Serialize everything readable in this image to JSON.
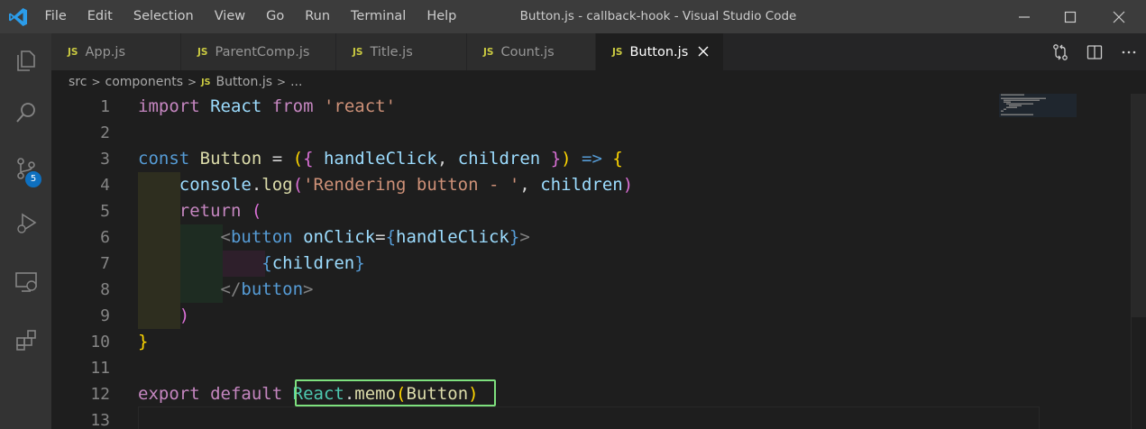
{
  "titlebar": {
    "menu": [
      "File",
      "Edit",
      "Selection",
      "View",
      "Go",
      "Run",
      "Terminal",
      "Help"
    ],
    "title": "Button.js - callback-hook - Visual Studio Code"
  },
  "activitybar": {
    "icons": [
      "explorer-icon",
      "search-icon",
      "source-control-icon",
      "run-debug-icon",
      "remote-explorer-icon",
      "extensions-icon"
    ],
    "source_control_badge": "5"
  },
  "tabs": [
    {
      "label": "App.js",
      "badge": "JS",
      "active": false
    },
    {
      "label": "ParentComp.js",
      "badge": "JS",
      "active": false
    },
    {
      "label": "Title.js",
      "badge": "JS",
      "active": false
    },
    {
      "label": "Count.js",
      "badge": "JS",
      "active": false
    },
    {
      "label": "Button.js",
      "badge": "JS",
      "active": true
    }
  ],
  "breadcrumb": {
    "parts": [
      "src",
      "components"
    ],
    "file_badge": "JS",
    "file": "Button.js",
    "tail": "..."
  },
  "editor": {
    "line_numbers": [
      "1",
      "2",
      "3",
      "4",
      "5",
      "6",
      "7",
      "8",
      "9",
      "10",
      "11",
      "12",
      "13"
    ]
  },
  "colors": {
    "highlight_box": "#7ee07e",
    "badge": "#0e70c0",
    "js_icon": "#cbcb41"
  }
}
